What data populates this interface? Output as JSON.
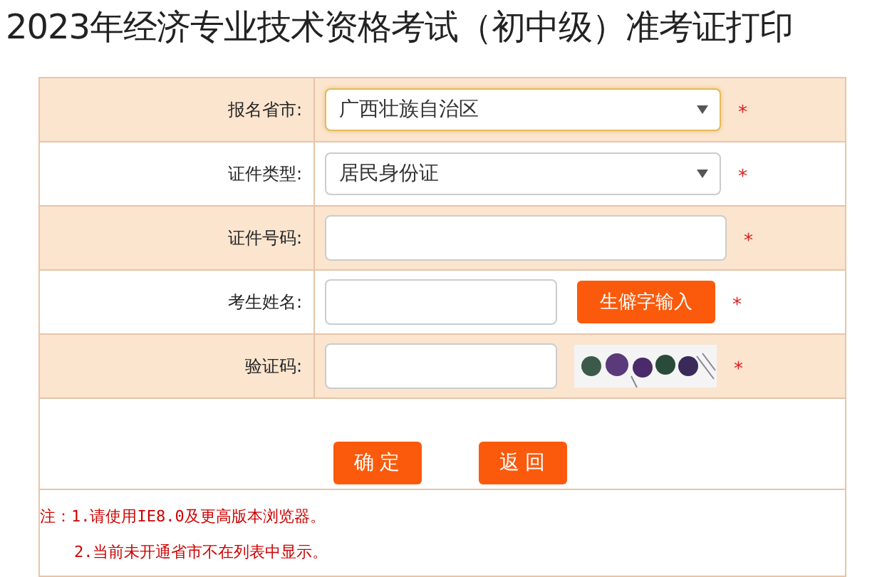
{
  "title": "2023年经济专业技术资格考试（初中级）准考证打印",
  "fields": [
    {
      "kind": "select",
      "label": "报名省市:",
      "value": "广西壮族自治区",
      "focused": true,
      "required_mark": "*"
    },
    {
      "kind": "select",
      "label": "证件类型:",
      "value": "居民身份证",
      "focused": false,
      "required_mark": "*"
    },
    {
      "kind": "input",
      "label": "证件号码:",
      "required_mark": "*"
    },
    {
      "kind": "input_button",
      "label": "考生姓名:",
      "button": "生僻字输入",
      "required_mark": "*"
    },
    {
      "kind": "captcha",
      "label": "验证码:",
      "required_mark": "*"
    }
  ],
  "buttons": [
    "确 定",
    "返 回"
  ],
  "notes": [
    "注：1.请使用IE8.0及更高版本浏览器。",
    "2.当前未开通省市不在列表中显示。"
  ]
}
